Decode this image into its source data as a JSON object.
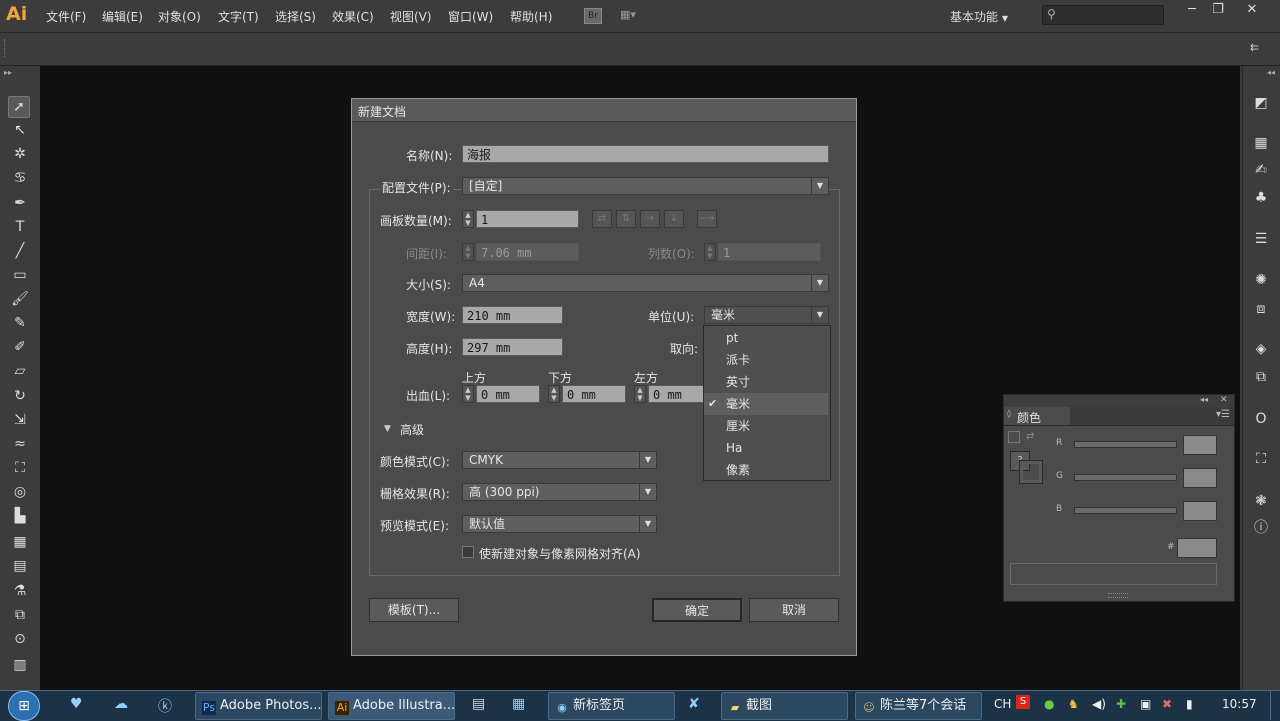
{
  "app": {
    "logo": "Ai"
  },
  "menus": [
    "文件(F)",
    "编辑(E)",
    "对象(O)",
    "文字(T)",
    "选择(S)",
    "效果(C)",
    "视图(V)",
    "窗口(W)",
    "帮助(H)"
  ],
  "menubar": {
    "bridge_label": "Br",
    "workspace": "基本功能"
  },
  "window_controls": [
    "─",
    "❐",
    "✕"
  ],
  "dialog": {
    "title": "新建文档",
    "name_label": "名称(N):",
    "name_value": "海报",
    "profile_label": "配置文件(P):",
    "profile_value": "[自定]",
    "artboards_label": "画板数量(M):",
    "artboards_value": "1",
    "spacing_label": "间距(I):",
    "spacing_value": "7.06 mm",
    "columns_label": "列数(O):",
    "columns_value": "1",
    "size_label": "大小(S):",
    "size_value": "A4",
    "width_label": "宽度(W):",
    "width_value": "210 mm",
    "units_label": "单位(U):",
    "units_value": "毫米",
    "height_label": "高度(H):",
    "height_value": "297 mm",
    "orientation_label": "取向:",
    "bleed_label": "出血(L):",
    "bleed_top_label": "上方",
    "bleed_top_value": "0 mm",
    "bleed_bottom_label": "下方",
    "bleed_bottom_value": "0 mm",
    "bleed_left_label": "左方",
    "bleed_left_value": "0 mm",
    "advanced_label": "高级",
    "color_mode_label": "颜色模式(C):",
    "color_mode_value": "CMYK",
    "raster_label": "栅格效果(R):",
    "raster_value": "高 (300 ppi)",
    "preview_label": "预览模式(E):",
    "preview_value": "默认值",
    "align_checkbox_label": "使新建对象与像素网格对齐(A)",
    "align_checked": false,
    "templates_button": "模板(T)...",
    "ok_button": "确定",
    "cancel_button": "取消"
  },
  "unit_options": [
    "pt",
    "派卡",
    "英寸",
    "毫米",
    "厘米",
    "Ha",
    "像素"
  ],
  "unit_selected": "毫米",
  "color_panel": {
    "title": "颜色",
    "r_label": "R",
    "g_label": "G",
    "b_label": "B",
    "hex_label": "#"
  },
  "taskbar": {
    "tasks": [
      "Adobe Photos...",
      "Adobe Illustra...",
      "新标签页",
      "截图",
      "陈兰等7个会话"
    ],
    "lang": "CH",
    "clock": "10:57"
  }
}
